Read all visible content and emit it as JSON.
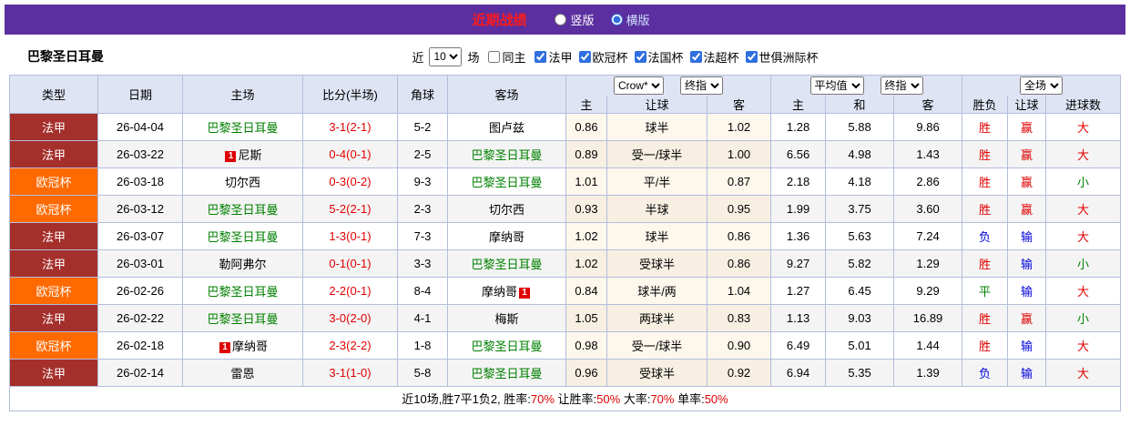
{
  "theme": {
    "purple": "#5b2f9f",
    "red": "#e00000",
    "green": "#008000",
    "blue": "#0000dd",
    "teamgreen": "#008000",
    "fa_bg": "#a42f2b",
    "ou_bg": "#ff6a00",
    "header_bg": "#dfe4f4",
    "grid_border": "#b3bedd"
  },
  "topbar": {
    "title": "近期战绩",
    "radios": [
      {
        "label": "竖版",
        "checked": false
      },
      {
        "label": "横版",
        "checked": true
      }
    ]
  },
  "filterbar": {
    "team": "巴黎圣日耳曼",
    "recent_label": "近",
    "recent_value": "10",
    "matches_label": "场",
    "same_home": {
      "label": "同主",
      "checked": false
    },
    "leagues": [
      {
        "label": "法甲",
        "checked": true
      },
      {
        "label": "欧冠杯",
        "checked": true
      },
      {
        "label": "法国杯",
        "checked": true
      },
      {
        "label": "法超杯",
        "checked": true
      },
      {
        "label": "世俱洲际杯",
        "checked": true
      }
    ]
  },
  "header": {
    "cols": [
      "类型",
      "日期",
      "主场",
      "比分(半场)",
      "角球",
      "客场"
    ],
    "selects": {
      "company": "Crow*",
      "company_time": "终指",
      "average": "平均值",
      "average_time": "终指",
      "scope": "全场"
    },
    "sub": [
      "主",
      "让球",
      "客",
      "主",
      "和",
      "客",
      "胜负",
      "让球",
      "进球数"
    ]
  },
  "rows": [
    {
      "type": {
        "label": "法甲",
        "key": "fa"
      },
      "date": "26-04-04",
      "home": {
        "name": "巴黎圣日耳曼",
        "team": true
      },
      "score": "3-1(2-1)",
      "corner": "5-2",
      "away": {
        "name": "图卢兹"
      },
      "odds": [
        "0.86",
        "球半",
        "1.02"
      ],
      "avg": [
        "1.28",
        "5.88",
        "9.86"
      ],
      "result": {
        "t": "胜",
        "c": "red"
      },
      "asian": {
        "t": "赢",
        "c": "red"
      },
      "goal": {
        "t": "大",
        "c": "red"
      }
    },
    {
      "type": {
        "label": "法甲",
        "key": "fa"
      },
      "date": "26-03-22",
      "home": {
        "badge": "1",
        "name": "尼斯"
      },
      "score": "0-4(0-1)",
      "corner": "2-5",
      "away": {
        "name": "巴黎圣日耳曼",
        "team": true
      },
      "odds": [
        "0.89",
        "受一/球半",
        "1.00"
      ],
      "avg": [
        "6.56",
        "4.98",
        "1.43"
      ],
      "result": {
        "t": "胜",
        "c": "red"
      },
      "asian": {
        "t": "赢",
        "c": "red"
      },
      "goal": {
        "t": "大",
        "c": "red"
      }
    },
    {
      "type": {
        "label": "欧冠杯",
        "key": "ou"
      },
      "date": "26-03-18",
      "home": {
        "name": "切尔西"
      },
      "score": "0-3(0-2)",
      "corner": "9-3",
      "away": {
        "name": "巴黎圣日耳曼",
        "team": true
      },
      "odds": [
        "1.01",
        "平/半",
        "0.87"
      ],
      "avg": [
        "2.18",
        "4.18",
        "2.86"
      ],
      "result": {
        "t": "胜",
        "c": "red"
      },
      "asian": {
        "t": "赢",
        "c": "red"
      },
      "goal": {
        "t": "小",
        "c": "green"
      }
    },
    {
      "type": {
        "label": "欧冠杯",
        "key": "ou"
      },
      "date": "26-03-12",
      "home": {
        "name": "巴黎圣日耳曼",
        "team": true
      },
      "score": "5-2(2-1)",
      "corner": "2-3",
      "away": {
        "name": "切尔西"
      },
      "odds": [
        "0.93",
        "半球",
        "0.95"
      ],
      "avg": [
        "1.99",
        "3.75",
        "3.60"
      ],
      "result": {
        "t": "胜",
        "c": "red"
      },
      "asian": {
        "t": "赢",
        "c": "red"
      },
      "goal": {
        "t": "大",
        "c": "red"
      }
    },
    {
      "type": {
        "label": "法甲",
        "key": "fa"
      },
      "date": "26-03-07",
      "home": {
        "name": "巴黎圣日耳曼",
        "team": true
      },
      "score": "1-3(0-1)",
      "corner": "7-3",
      "away": {
        "name": "摩纳哥"
      },
      "odds": [
        "1.02",
        "球半",
        "0.86"
      ],
      "avg": [
        "1.36",
        "5.63",
        "7.24"
      ],
      "result": {
        "t": "负",
        "c": "blue"
      },
      "asian": {
        "t": "输",
        "c": "blue"
      },
      "goal": {
        "t": "大",
        "c": "red"
      }
    },
    {
      "type": {
        "label": "法甲",
        "key": "fa"
      },
      "date": "26-03-01",
      "home": {
        "name": "勒阿弗尔"
      },
      "score": "0-1(0-1)",
      "corner": "3-3",
      "away": {
        "name": "巴黎圣日耳曼",
        "team": true
      },
      "odds": [
        "1.02",
        "受球半",
        "0.86"
      ],
      "avg": [
        "9.27",
        "5.82",
        "1.29"
      ],
      "result": {
        "t": "胜",
        "c": "red"
      },
      "asian": {
        "t": "输",
        "c": "blue"
      },
      "goal": {
        "t": "小",
        "c": "green"
      }
    },
    {
      "type": {
        "label": "欧冠杯",
        "key": "ou"
      },
      "date": "26-02-26",
      "home": {
        "name": "巴黎圣日耳曼",
        "team": true
      },
      "score": "2-2(0-1)",
      "corner": "8-4",
      "away": {
        "name": "摩纳哥",
        "badge": "1"
      },
      "odds": [
        "0.84",
        "球半/两",
        "1.04"
      ],
      "avg": [
        "1.27",
        "6.45",
        "9.29"
      ],
      "result": {
        "t": "平",
        "c": "green"
      },
      "asian": {
        "t": "输",
        "c": "blue"
      },
      "goal": {
        "t": "大",
        "c": "red"
      }
    },
    {
      "type": {
        "label": "法甲",
        "key": "fa"
      },
      "date": "26-02-22",
      "home": {
        "name": "巴黎圣日耳曼",
        "team": true
      },
      "score": "3-0(2-0)",
      "corner": "4-1",
      "away": {
        "name": "梅斯"
      },
      "odds": [
        "1.05",
        "两球半",
        "0.83"
      ],
      "avg": [
        "1.13",
        "9.03",
        "16.89"
      ],
      "result": {
        "t": "胜",
        "c": "red"
      },
      "asian": {
        "t": "赢",
        "c": "red"
      },
      "goal": {
        "t": "小",
        "c": "green"
      }
    },
    {
      "type": {
        "label": "欧冠杯",
        "key": "ou"
      },
      "date": "26-02-18",
      "home": {
        "badge": "1",
        "name": "摩纳哥"
      },
      "score": "2-3(2-2)",
      "corner": "1-8",
      "away": {
        "name": "巴黎圣日耳曼",
        "team": true
      },
      "odds": [
        "0.98",
        "受一/球半",
        "0.90"
      ],
      "avg": [
        "6.49",
        "5.01",
        "1.44"
      ],
      "result": {
        "t": "胜",
        "c": "red"
      },
      "asian": {
        "t": "输",
        "c": "blue"
      },
      "goal": {
        "t": "大",
        "c": "red"
      }
    },
    {
      "type": {
        "label": "法甲",
        "key": "fa"
      },
      "date": "26-02-14",
      "home": {
        "name": "雷恩"
      },
      "score": "3-1(1-0)",
      "corner": "5-8",
      "away": {
        "name": "巴黎圣日耳曼",
        "team": true
      },
      "odds": [
        "0.96",
        "受球半",
        "0.92"
      ],
      "avg": [
        "6.94",
        "5.35",
        "1.39"
      ],
      "result": {
        "t": "负",
        "c": "blue"
      },
      "asian": {
        "t": "输",
        "c": "blue"
      },
      "goal": {
        "t": "大",
        "c": "red"
      }
    }
  ],
  "footer": {
    "parts": [
      {
        "t": "近10场,胜7平1负2, 胜率:",
        "red": false
      },
      {
        "t": "70%",
        "red": true
      },
      {
        "t": " 让胜率:",
        "red": false
      },
      {
        "t": "50%",
        "red": true
      },
      {
        "t": " 大率:",
        "red": false
      },
      {
        "t": "70%",
        "red": true
      },
      {
        "t": " 单率:",
        "red": false
      },
      {
        "t": "50%",
        "red": true
      }
    ]
  }
}
